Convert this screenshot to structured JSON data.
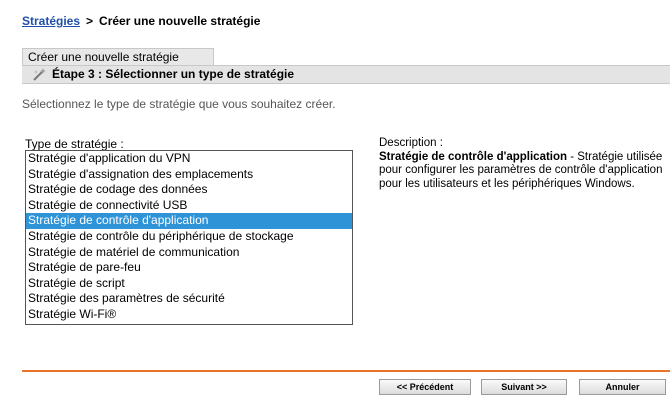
{
  "breadcrumb": {
    "link": "Stratégies",
    "separator": ">",
    "current": "Créer une nouvelle stratégie"
  },
  "tab": {
    "label": "Créer une nouvelle stratégie"
  },
  "step": {
    "title": "Étape 3 : Sélectionner un type de stratégie",
    "icon": "wizard-wand-icon"
  },
  "intro": "Sélectionnez le type de stratégie que vous souhaitez créer.",
  "policy_type": {
    "label": "Type de stratégie :",
    "options": [
      "Stratégie d'application du VPN",
      "Stratégie d'assignation des emplacements",
      "Stratégie de codage des données",
      "Stratégie de connectivité USB",
      "Stratégie de contrôle d'application",
      "Stratégie de contrôle du périphérique de stockage",
      "Stratégie de matériel de communication",
      "Stratégie de pare-feu",
      "Stratégie de script",
      "Stratégie des paramètres de sécurité",
      "Stratégie Wi-Fi®"
    ],
    "selected": "Stratégie de contrôle d'application"
  },
  "description": {
    "label": "Description :",
    "title": "Stratégie de contrôle d'application",
    "text": " - Stratégie utilisée pour configurer les paramètres de contrôle d'application pour les utilisateurs et les périphériques Windows."
  },
  "buttons": {
    "previous": "<< Précédent",
    "next": "Suivant >>",
    "cancel": "Annuler"
  },
  "colors": {
    "accent_divider": "#e8732b",
    "selection": "#2f93d8",
    "link": "#1f4fa8"
  }
}
